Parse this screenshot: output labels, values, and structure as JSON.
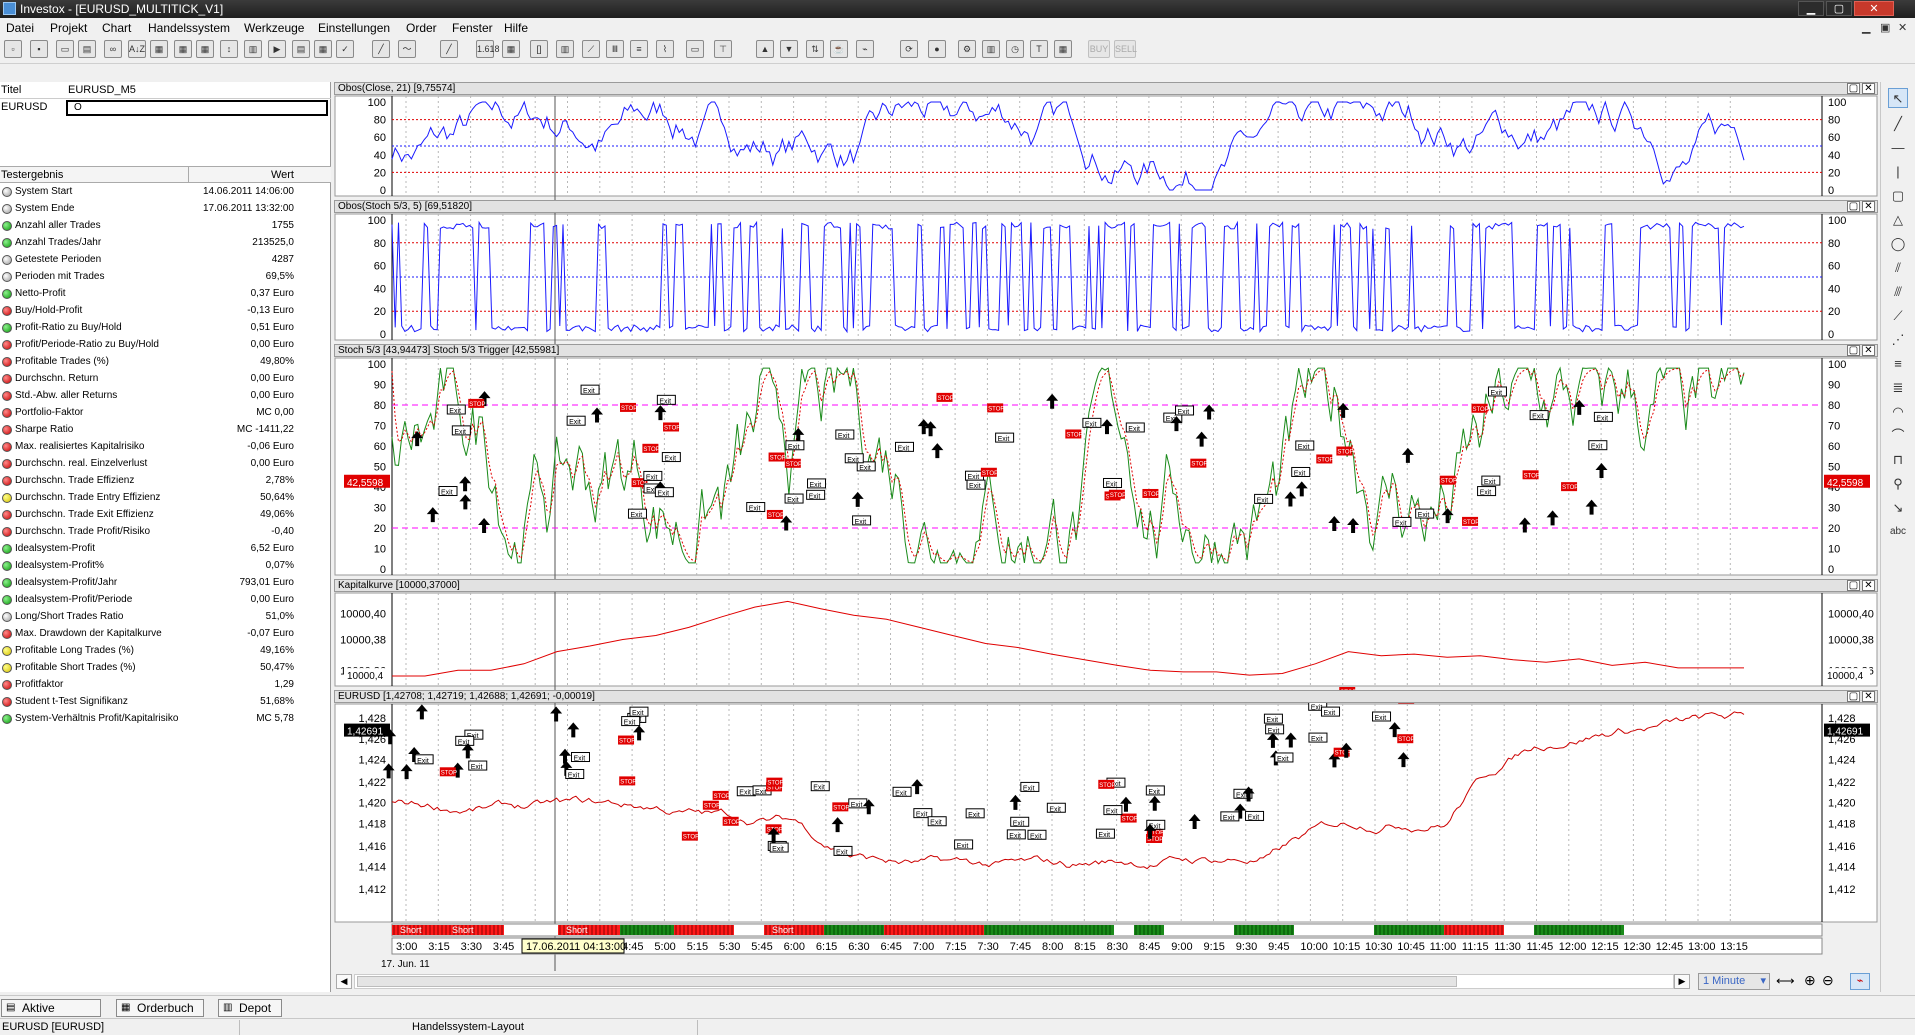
{
  "window": {
    "title": "Investox - [EURUSD_MULTITICK_V1]",
    "min": "▁",
    "max": "▢",
    "close": "✕"
  },
  "menu": {
    "items": [
      "Datei",
      "Projekt",
      "Chart",
      "Handelssystem",
      "Werkzeuge",
      "Einstellungen",
      "Order",
      "Fenster",
      "Hilfe"
    ],
    "mdi": [
      "▁",
      "▣",
      "✕"
    ]
  },
  "toolbar": {
    "labels": {
      "fib": "1.618",
      "buy": "BUY",
      "sell": "SELL",
      "ab": "A↓Z"
    }
  },
  "leftpane": {
    "header": {
      "col1": "Titel",
      "col2": "EURUSD_M5"
    },
    "symbol": {
      "name": "EURUSD",
      "value": "O"
    },
    "results_header": {
      "col1": "Testergebnis",
      "col2": "Wert"
    },
    "results": [
      {
        "status": "gray",
        "name": "System Start",
        "value": "14.06.2011 14:06:00"
      },
      {
        "status": "gray",
        "name": "System Ende",
        "value": "17.06.2011 13:32:00"
      },
      {
        "status": "green",
        "name": "Anzahl aller Trades",
        "value": "1755"
      },
      {
        "status": "green",
        "name": "Anzahl Trades/Jahr",
        "value": "213525,0"
      },
      {
        "status": "gray",
        "name": "Getestete Perioden",
        "value": "4287"
      },
      {
        "status": "gray",
        "name": "Perioden mit Trades",
        "value": "69,5%"
      },
      {
        "status": "green",
        "name": "Netto-Profit",
        "value": "0,37 Euro"
      },
      {
        "status": "red",
        "name": "Buy/Hold-Profit",
        "value": "-0,13 Euro"
      },
      {
        "status": "green",
        "name": "Profit-Ratio zu Buy/Hold",
        "value": "0,51 Euro"
      },
      {
        "status": "red",
        "name": "Profit/Periode-Ratio zu Buy/Hold",
        "value": "0,00 Euro"
      },
      {
        "status": "red",
        "name": "Profitable Trades (%)",
        "value": "49,80%"
      },
      {
        "status": "red",
        "name": "Durchschn. Return",
        "value": "0,00 Euro"
      },
      {
        "status": "red",
        "name": "Std.-Abw. aller Returns",
        "value": "0,00 Euro"
      },
      {
        "status": "red",
        "name": "Portfolio-Faktor",
        "value": "MC 0,00"
      },
      {
        "status": "red",
        "name": "Sharpe Ratio",
        "value": "MC -1411,22"
      },
      {
        "status": "red",
        "name": "Max. realisiertes Kapitalrisiko",
        "value": "-0,06 Euro"
      },
      {
        "status": "red",
        "name": "Durchschn. real. Einzelverlust",
        "value": "0,00 Euro"
      },
      {
        "status": "red",
        "name": "Durchschn. Trade Effizienz",
        "value": "2,78%"
      },
      {
        "status": "yellow",
        "name": "Durchschn. Trade Entry Effizienz",
        "value": "50,64%"
      },
      {
        "status": "red",
        "name": "Durchschn. Trade Exit Effizienz",
        "value": "49,06%"
      },
      {
        "status": "red",
        "name": "Durchschn. Trade Profit/Risiko",
        "value": "-0,40"
      },
      {
        "status": "green",
        "name": "Idealsystem-Profit",
        "value": "6,52 Euro"
      },
      {
        "status": "green",
        "name": "Idealsystem-Profit%",
        "value": "0,07%"
      },
      {
        "status": "green",
        "name": "Idealsystem-Profit/Jahr",
        "value": "793,01 Euro"
      },
      {
        "status": "green",
        "name": "Idealsystem-Profit/Periode",
        "value": "0,00 Euro"
      },
      {
        "status": "gray",
        "name": "Long/Short Trades Ratio",
        "value": "51,0%"
      },
      {
        "status": "red",
        "name": "Max. Drawdown der Kapitalkurve",
        "value": "-0,07 Euro"
      },
      {
        "status": "yellow",
        "name": "Profitable Long Trades (%)",
        "value": "49,16%"
      },
      {
        "status": "yellow",
        "name": "Profitable Short Trades (%)",
        "value": "50,47%"
      },
      {
        "status": "red",
        "name": "Profitfaktor",
        "value": "1,29"
      },
      {
        "status": "red",
        "name": "Student t-Test Signifikanz",
        "value": "51,68%"
      },
      {
        "status": "green",
        "name": "System-Verhältnis Profit/Kapitalrisiko",
        "value": "MC 5,78"
      }
    ]
  },
  "panels": {
    "p1": {
      "title": "Obos(Close, 21) [9,75574]",
      "ticks": [
        "100",
        "80",
        "60",
        "40",
        "20",
        "0"
      ]
    },
    "p2": {
      "title": "Obos(Stoch 5/3, 5) [69,51820]",
      "ticks": [
        "100",
        "80",
        "60",
        "40",
        "20",
        "0"
      ]
    },
    "p3": {
      "title": "Stoch 5/3 [43,94473]   Stoch 5/3 Trigger [42,55981]",
      "ticks": [
        "100",
        "90",
        "80",
        "70",
        "60",
        "50",
        "40",
        "30",
        "20",
        "10",
        "0"
      ],
      "marker": "42,5598"
    },
    "p4": {
      "title": "Kapitalkurve [10000,37000]",
      "ticks": [
        "10000,40",
        "10000,38",
        "10000,36"
      ],
      "marker": "10000,4"
    },
    "p5": {
      "title": "EURUSD [1,42708; 1,42719; 1,42688; 1,42691; -0,00019]",
      "ticks": [
        "1,428",
        "1,426",
        "1,424",
        "1,422",
        "1,420",
        "1,418",
        "1,416",
        "1,414",
        "1,412"
      ],
      "marker": "1,42691"
    }
  },
  "labels": {
    "exit": "Exit",
    "stop": "STOP",
    "short": "Short",
    "panel_min": "▢",
    "panel_close": "✕"
  },
  "timeaxis": {
    "times": [
      "3:00",
      "3:15",
      "3:30",
      "3:45",
      "4:00",
      "4:15",
      "4:30",
      "4:45",
      "5:00",
      "5:15",
      "5:30",
      "5:45",
      "6:00",
      "6:15",
      "6:30",
      "6:45",
      "7:00",
      "7:15",
      "7:30",
      "7:45",
      "8:00",
      "8:15",
      "8:30",
      "8:45",
      "9:00",
      "9:15",
      "9:30",
      "9:45",
      "10:00",
      "10:15",
      "10:30",
      "10:45",
      "11:00",
      "11:15",
      "11:30",
      "11:45",
      "12:00",
      "12:15",
      "12:30",
      "12:45",
      "13:00",
      "13:15"
    ],
    "date": "17. Jun. 11",
    "cursor": "17.06.2011 04:13:00"
  },
  "nav": {
    "interval": "1 Minute",
    "interval_arrow": "▾",
    "scroll_left": "◀",
    "scroll_right": "▶",
    "pan": "⟷",
    "zoom_in": "⊕",
    "zoom_out": "⊖"
  },
  "bottomtabs": [
    {
      "label": "Aktive Systeme",
      "icon": "▤"
    },
    {
      "label": "Orderbuch",
      "icon": "▦"
    },
    {
      "label": "Depot",
      "icon": "▥"
    }
  ],
  "statusbar": {
    "left": "EURUSD [EURUSD]",
    "right": "Handelssystem-Layout"
  },
  "colors": {
    "blue": "#1a1aff",
    "red": "#e00000",
    "green": "#1a8a1a",
    "magenta": "#ff00ff",
    "short_bar": "#ff1a1a"
  }
}
